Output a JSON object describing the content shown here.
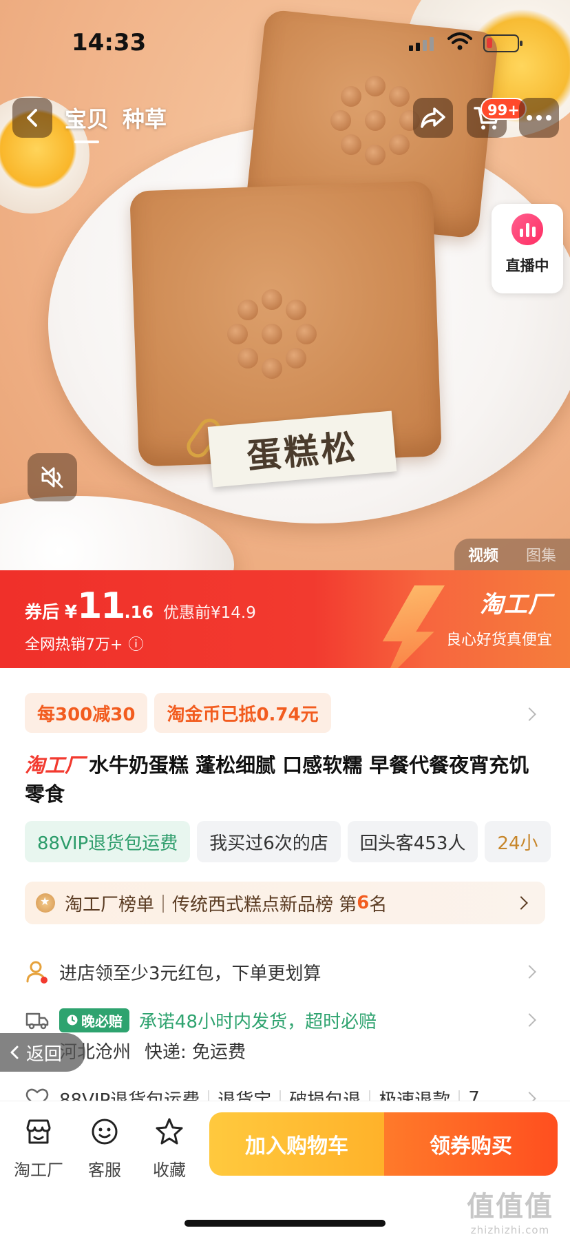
{
  "status_bar": {
    "time": "14:33"
  },
  "nav": {
    "tabs": [
      {
        "label": "宝贝"
      },
      {
        "label": "种草"
      }
    ],
    "cart_badge": "99+"
  },
  "media": {
    "image_label": "蛋糕松",
    "live_label": "直播中",
    "tabs": [
      {
        "label": "视频"
      },
      {
        "label": "图集"
      }
    ]
  },
  "price": {
    "label": "券后",
    "currency": "¥",
    "integer": "11",
    "decimal": ".16",
    "original": "优惠前¥14.9",
    "sales": "全网热销7万+",
    "info_icon": "ⓘ",
    "brand": "淘工厂",
    "slogan": "良心好货真便宜"
  },
  "coupons": [
    {
      "label": "每300减30"
    },
    {
      "label": "淘金币已抵0.74元"
    }
  ],
  "product": {
    "brand": "淘工厂",
    "title": "水牛奶蛋糕 蓬松细腻 口感软糯 早餐代餐夜宵充饥零食"
  },
  "chips": [
    {
      "label": "88VIP退货包运费"
    },
    {
      "label": "我买过6次的店"
    },
    {
      "label": "回头客453人"
    },
    {
      "label": "24小"
    }
  ],
  "rank": {
    "prefix": "淘工厂榜单｜传统西式糕点新品榜  第",
    "number": "6",
    "suffix": "名"
  },
  "redpack": {
    "text": "进店领至少3元红包，下单更划算"
  },
  "shipping": {
    "badge": "晚必赔",
    "promise": "承诺48小时内发货，超时必赔",
    "origin": "河北沧州",
    "express": "快递: 免运费"
  },
  "guarantees": [
    {
      "label": "88VIP退货包运费"
    },
    {
      "label": "退货宝"
    },
    {
      "label": "破损包退"
    },
    {
      "label": "极速退款"
    },
    {
      "label": "7"
    }
  ],
  "back_label": "返回",
  "bottom": {
    "items": [
      {
        "label": "淘工厂"
      },
      {
        "label": "客服"
      },
      {
        "label": "收藏"
      }
    ],
    "cart_button": "加入购物车",
    "buy_button": "领券购买"
  },
  "watermark": {
    "line1": "值值值",
    "line2": "zhizhizhi.com"
  },
  "colors": {
    "accent_red": "#f23a2f",
    "orange": "#f25c1f",
    "green": "#2ea36f"
  }
}
